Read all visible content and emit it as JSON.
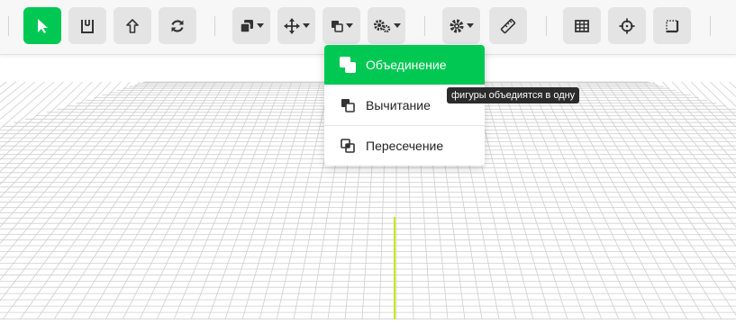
{
  "toolbar": {
    "tools": [
      {
        "name": "select-tool",
        "icon": "cursor-icon"
      },
      {
        "name": "measure-ruler-tool",
        "icon": "ruler-bracket-icon"
      },
      {
        "name": "extrude-tool",
        "icon": "arrow-up-outline-icon"
      },
      {
        "name": "rotate-tool",
        "icon": "refresh-icon"
      },
      {
        "name": "copy-tool",
        "icon": "copy-shapes-icon"
      },
      {
        "name": "move-tool",
        "icon": "move-arrows-icon"
      },
      {
        "name": "boolean-tool",
        "icon": "boolean-shapes-icon"
      },
      {
        "name": "settings-group-tool",
        "icon": "gears-icon"
      },
      {
        "name": "settings-tool",
        "icon": "gear-icon"
      },
      {
        "name": "ruler-tool",
        "icon": "ruler-icon"
      },
      {
        "name": "table-tool",
        "icon": "table-icon"
      },
      {
        "name": "crosshair-tool",
        "icon": "crosshair-icon"
      },
      {
        "name": "frame-tool",
        "icon": "frame-corner-icon"
      }
    ]
  },
  "boolean_menu": {
    "items": [
      {
        "label": "Объединение",
        "icon": "union-icon",
        "active": true
      },
      {
        "label": "Вычитание",
        "icon": "subtract-icon",
        "active": false
      },
      {
        "label": "Пересечение",
        "icon": "intersect-icon",
        "active": false
      }
    ]
  },
  "tooltip": {
    "text": "фигуры объедиятся в одну"
  },
  "colors": {
    "accent": "#00c853",
    "toolbar_bg": "#f7f7f7",
    "button_bg": "#e4e4e4",
    "grid_line": "#cfcfcf",
    "axis_line": "#c6e800",
    "tooltip_bg": "#2b2b2b"
  }
}
